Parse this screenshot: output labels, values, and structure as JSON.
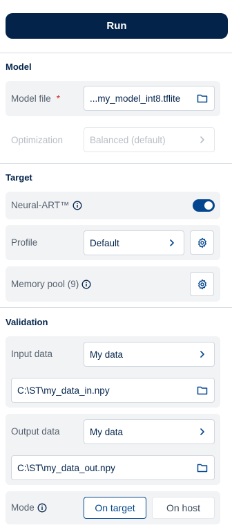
{
  "run_button": {
    "label": "Run"
  },
  "model": {
    "title": "Model",
    "model_file": {
      "label": "Model file",
      "required_mark": "*",
      "value": "...my_model_int8.tflite"
    },
    "optimization": {
      "label": "Optimization",
      "value": "Balanced (default)"
    }
  },
  "target": {
    "title": "Target",
    "neural_art": {
      "label": "Neural-ART™",
      "enabled": true
    },
    "profile": {
      "label": "Profile",
      "value": "Default"
    },
    "memory_pool": {
      "label": "Memory pool (9)"
    }
  },
  "validation": {
    "title": "Validation",
    "input_data": {
      "label": "Input data",
      "value": "My data",
      "path": "C:\\ST\\my_data_in.npy"
    },
    "output_data": {
      "label": "Output data",
      "value": "My data",
      "path": "C:\\ST\\my_data_out.npy"
    },
    "mode": {
      "label": "Mode",
      "options": [
        "On target",
        "On host"
      ],
      "selected": "On target"
    }
  },
  "colors": {
    "primary": "#03234b",
    "accent": "#03468f",
    "card_bg": "#f2f3f5",
    "required": "#d62828"
  },
  "icons": [
    "folder-icon",
    "chevron-right-icon",
    "info-icon",
    "gear-icon"
  ]
}
